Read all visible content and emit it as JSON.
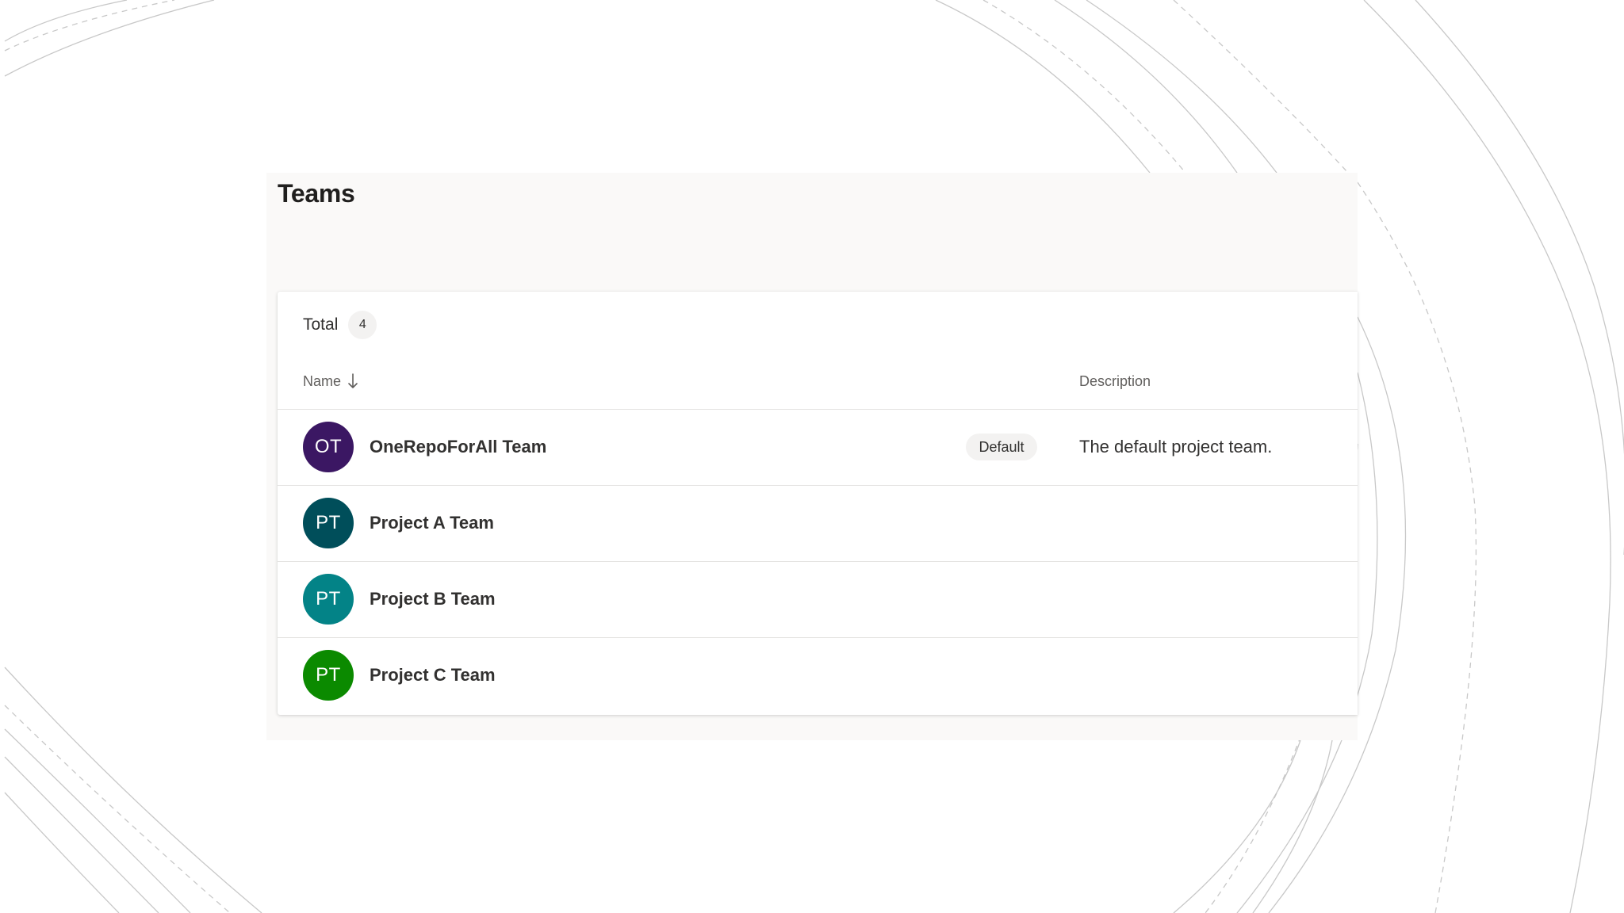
{
  "page": {
    "title": "Teams"
  },
  "summary": {
    "total_label": "Total",
    "total_count": "4"
  },
  "columns": {
    "name": "Name",
    "name_sort": "descending",
    "description": "Description"
  },
  "teams": [
    {
      "initials": "OT",
      "name": "OneRepoForAll Team",
      "badge": "Default",
      "description": "The default project team.",
      "avatar_color": "#3b1763"
    },
    {
      "initials": "PT",
      "name": "Project A Team",
      "badge": "",
      "description": "",
      "avatar_color": "#004e5a"
    },
    {
      "initials": "PT",
      "name": "Project B Team",
      "badge": "",
      "description": "",
      "avatar_color": "#038387"
    },
    {
      "initials": "PT",
      "name": "Project C Team",
      "badge": "",
      "description": "",
      "avatar_color": "#0b8a00"
    }
  ]
}
